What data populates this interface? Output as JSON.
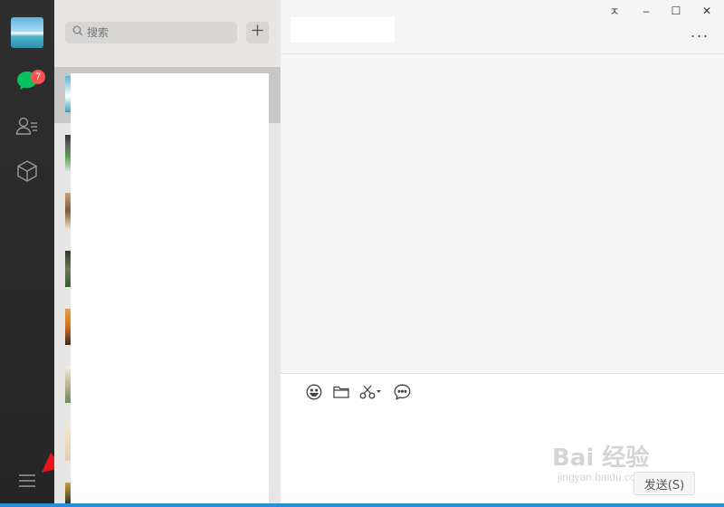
{
  "search": {
    "placeholder": "搜索"
  },
  "nav": {
    "unread_count": "7"
  },
  "window_controls": {
    "pin": "ㅈ",
    "minimize": "–",
    "maximize": "☐",
    "close": "✕"
  },
  "header": {
    "more": "···"
  },
  "composer": {
    "send_label": "发送(S)"
  },
  "watermark": {
    "main": "Bai 经验",
    "sub": "jingyan.baidu.com"
  },
  "colors": {
    "accent_green": "#07c160",
    "badge_red": "#fa5151",
    "annotation_arrow": "#e8141b"
  }
}
